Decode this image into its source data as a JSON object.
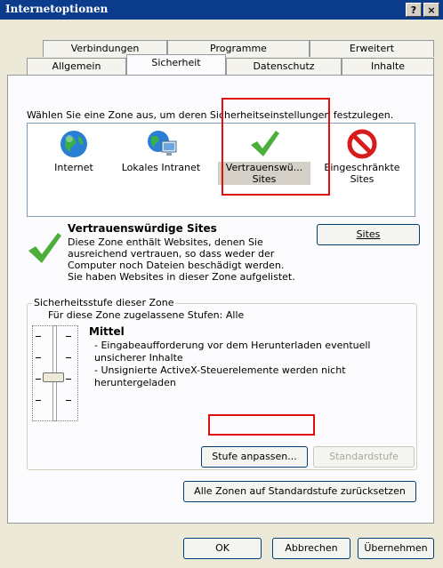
{
  "window": {
    "title": "Internetoptionen",
    "help_label": "?",
    "close_label": "×"
  },
  "tabs": {
    "row1": [
      "Verbindungen",
      "Programme",
      "Erweitert"
    ],
    "row2": [
      "Allgemein",
      "Sicherheit",
      "Datenschutz",
      "Inhalte"
    ],
    "active": "Sicherheit"
  },
  "zones": {
    "instruction": "Wählen Sie eine Zone aus, um deren Sicherheitseinstellungen festzulegen.",
    "items": [
      {
        "label": "Internet",
        "label2": "",
        "icon": "globe-icon"
      },
      {
        "label": "Lokales Intranet",
        "label2": "",
        "icon": "intranet-icon"
      },
      {
        "label": "Vertrauenswü...",
        "label2": "Sites",
        "icon": "checkmark-icon"
      },
      {
        "label": "Eingeschränkte",
        "label2": "Sites",
        "icon": "prohibited-icon"
      }
    ]
  },
  "selected_zone": {
    "title": "Vertrauenswürdige Sites",
    "description": [
      "Diese Zone enthält Websites, denen Sie",
      "ausreichend vertrauen, so dass weder der",
      "Computer noch Dateien beschädigt werden.",
      "Sie haben Websites in dieser Zone aufgelistet."
    ],
    "sites_button": "Sites"
  },
  "security_level": {
    "group_title": "Sicherheitsstufe dieser Zone",
    "allowed": "Für diese Zone zugelassene Stufen: Alle",
    "level_name": "Mittel",
    "details": [
      "- Eingabeaufforderung vor dem Herunterladen eventuell",
      "unsicherer Inhalte",
      "- Unsignierte ActiveX-Steuerelemente werden nicht",
      "heruntergeladen"
    ],
    "custom_button": "Stufe anpassen...",
    "default_button": "Standardstufe"
  },
  "reset_all_button": "Alle Zonen auf Standardstufe zurücksetzen",
  "footer": {
    "ok": "OK",
    "cancel": "Abbrechen",
    "apply": "Übernehmen"
  },
  "colors": {
    "highlight": "#e01010",
    "check": "#4caf3a",
    "titlebar": "#0b3c8c"
  }
}
